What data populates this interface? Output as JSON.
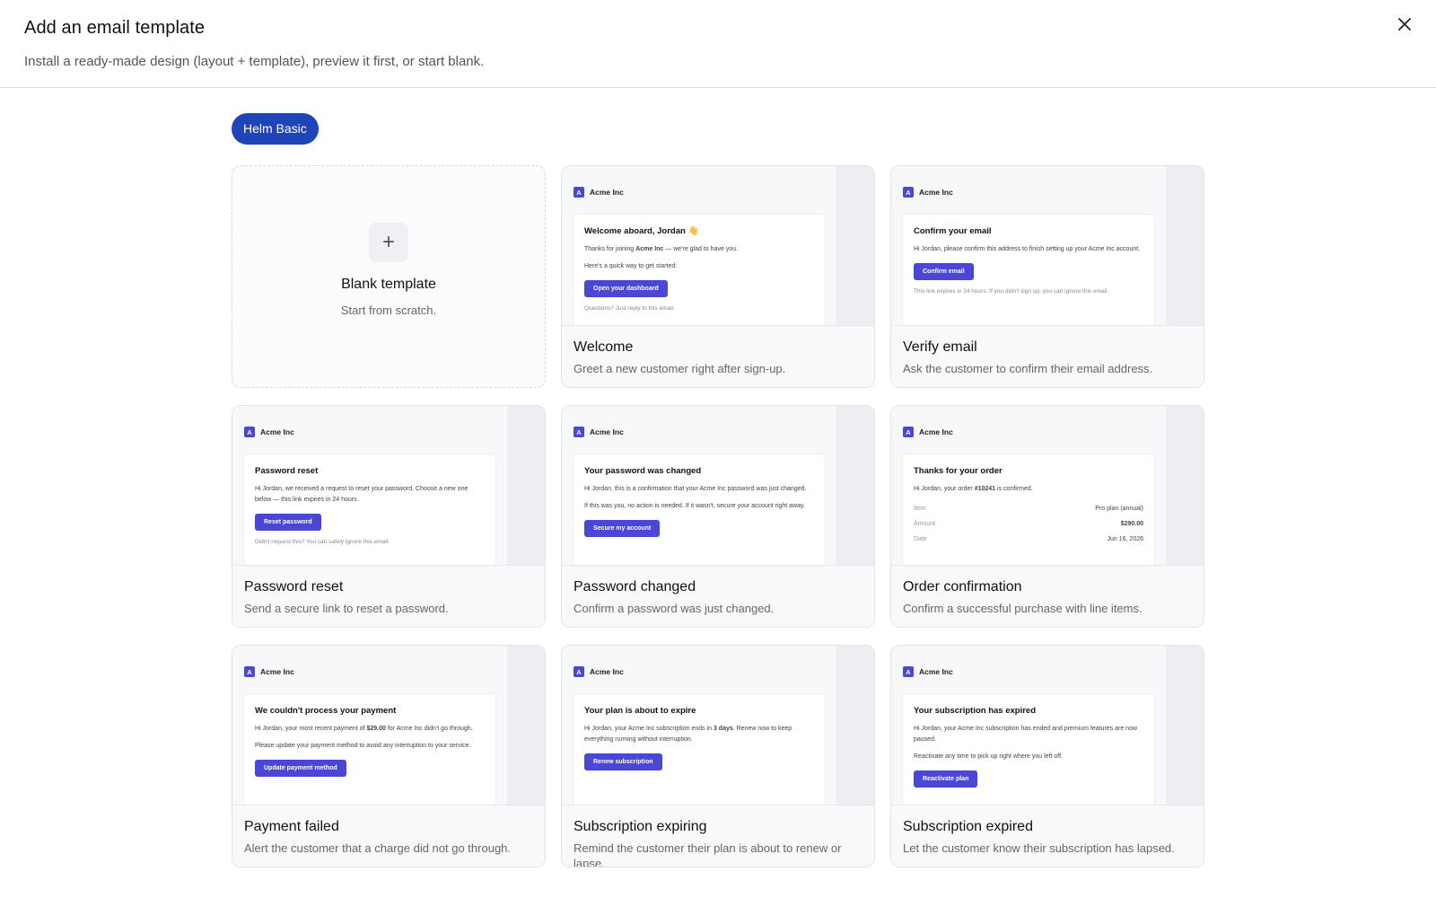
{
  "header": {
    "title": "Add an email template",
    "subtitle": "Install a ready-made design (layout + template), preview it first, or start blank."
  },
  "filter_chip": "Helm Basic",
  "blank": {
    "title": "Blank template",
    "subtitle": "Start from scratch."
  },
  "brand": {
    "name": "Acme Inc",
    "mark": "A"
  },
  "cards": {
    "welcome": {
      "title": "Welcome",
      "desc": "Greet a new customer right after sign-up.",
      "heading": "Welcome aboard, Jordan 👋",
      "l1a": "Thanks for joining ",
      "l1b": "Acme Inc",
      "l1c": " — we're glad to have you.",
      "l2": "Here's a quick way to get started:",
      "button": "Open your dashboard",
      "foot": "Questions? Just reply to this email."
    },
    "verify": {
      "title": "Verify email",
      "desc": "Ask the customer to confirm their email address.",
      "heading": "Confirm your email",
      "l1": "Hi Jordan, please confirm this address to finish setting up your Acme Inc account.",
      "button": "Confirm email",
      "foot": "This link expires in 24 hours. If you didn't sign up, you can ignore this email."
    },
    "reset": {
      "title": "Password reset",
      "desc": "Send a secure link to reset a password.",
      "heading": "Password reset",
      "l1": "Hi Jordan, we received a request to reset your password. Choose a new one below — this link expires in 24 hours.",
      "button": "Reset password",
      "foot": "Didn't request this? You can safely ignore this email."
    },
    "changed": {
      "title": "Password changed",
      "desc": "Confirm a password was just changed.",
      "heading": "Your password was changed",
      "l1": "Hi Jordan, this is a confirmation that your Acme Inc password was just changed.",
      "l2": "If this was you, no action is needed. If it wasn't, secure your account right away.",
      "button": "Secure my account"
    },
    "order": {
      "title": "Order confirmation",
      "desc": "Confirm a successful purchase with line items.",
      "heading": "Thanks for your order",
      "l1a": "Hi Jordan, your order ",
      "l1b": "#10241",
      "l1c": " is confirmed.",
      "rows": [
        {
          "k": "Item",
          "v": "Pro plan (annual)"
        },
        {
          "k": "Amount",
          "v": "$290.00"
        },
        {
          "k": "Date",
          "v": "Jun 16, 2026"
        }
      ]
    },
    "failed": {
      "title": "Payment failed",
      "desc": "Alert the customer that a charge did not go through.",
      "heading": "We couldn't process your payment",
      "l1a": "Hi Jordan, your most recent payment of ",
      "l1b": "$29.00",
      "l1c": " for Acme Inc didn't go through.",
      "l2": "Please update your payment method to avoid any interruption to your service.",
      "button": "Update payment method"
    },
    "expiring": {
      "title": "Subscription expiring",
      "desc": "Remind the customer their plan is about to renew or lapse.",
      "heading": "Your plan is about to expire",
      "l1a": "Hi Jordan, your Acme Inc subscription ends in ",
      "l1b": "3 days",
      "l1c": ". Renew now to keep everything running without interruption.",
      "button": "Renew subscription"
    },
    "expired": {
      "title": "Subscription expired",
      "desc": "Let the customer know their subscription has lapsed.",
      "heading": "Your subscription has expired",
      "l1": "Hi Jordan, your Acme Inc subscription has ended and premium features are now paused.",
      "l2": "Reactivate any time to pick up right where you left off.",
      "button": "Reactivate plan"
    }
  },
  "colors": {
    "chip": "#1f43b8",
    "brand": "#4a46d6"
  }
}
